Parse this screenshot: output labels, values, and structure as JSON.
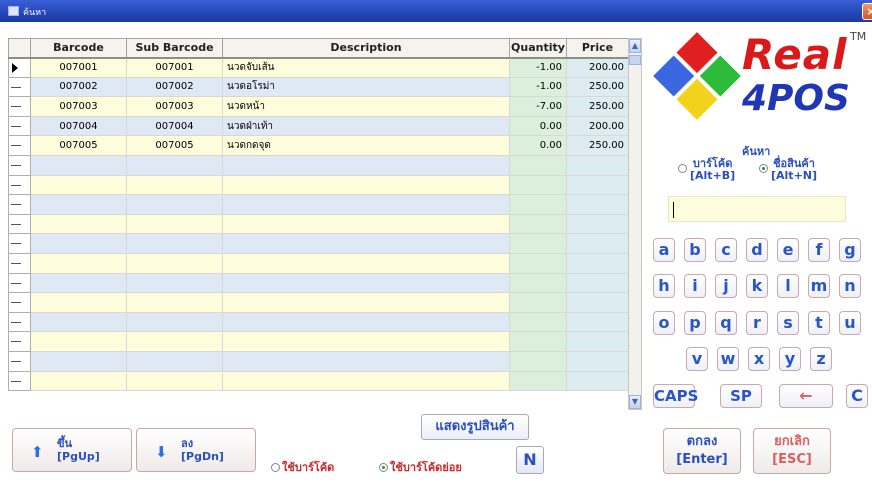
{
  "window": {
    "title": "ค้นหา",
    "close_label": "×"
  },
  "grid": {
    "columns": [
      "Barcode",
      "Sub Barcode",
      "Description",
      "Quantity",
      "Price"
    ],
    "rows": [
      {
        "barcode": "007001",
        "sub_barcode": "007001",
        "description": "นวดจับเส้น",
        "quantity": "-1.00",
        "price": "200.00"
      },
      {
        "barcode": "007002",
        "sub_barcode": "007002",
        "description": "นวดอโรม่า",
        "quantity": "-1.00",
        "price": "250.00"
      },
      {
        "barcode": "007003",
        "sub_barcode": "007003",
        "description": "นวดหน้า",
        "quantity": "-7.00",
        "price": "250.00"
      },
      {
        "barcode": "007004",
        "sub_barcode": "007004",
        "description": "นวดฝ่าเท้า",
        "quantity": "0.00",
        "price": "200.00"
      },
      {
        "barcode": "007005",
        "sub_barcode": "007005",
        "description": "นวดกดจุด",
        "quantity": "0.00",
        "price": "250.00"
      }
    ]
  },
  "bottom": {
    "pgup_label": "ขึ้น",
    "pgup_key": "[PgUp]",
    "pgdn_label": "ลง",
    "pgdn_key": "[PgDn]",
    "radio_barcode": "ใช้บาร์โค้ด",
    "radio_sub_barcode": "ใช้บาร์โค้ดย่อย",
    "show_image_label": "แสดงรูปสินค้า",
    "n_label": "N"
  },
  "right": {
    "logo_line1": "Real",
    "logo_line2": "4POS",
    "tm": "TM",
    "search_title": "ค้นหา",
    "option_barcode": "บาร์โค้ด",
    "option_barcode_key": "[Alt+B]",
    "option_name": "ชื่อสินค้า",
    "option_name_key": "[Alt+N]",
    "search_value": "",
    "keys_row1": [
      "a",
      "b",
      "c",
      "d",
      "e",
      "f",
      "g"
    ],
    "keys_row2": [
      "h",
      "i",
      "j",
      "k",
      "l",
      "m",
      "n"
    ],
    "keys_row3": [
      "o",
      "p",
      "q",
      "r",
      "s",
      "t",
      "u"
    ],
    "keys_row4": [
      "v",
      "w",
      "x",
      "y",
      "z"
    ],
    "caps_label": "CAPS",
    "sp_label": "SP",
    "backspace_label": "←",
    "clear_label": "C",
    "ok_label": "ตกลง",
    "ok_key": "[Enter]",
    "cancel_label": "ยกเลิก",
    "cancel_key": "[ESC]"
  },
  "colors": {
    "accent": "#2a4fbf",
    "danger": "#e05d5d",
    "row_yellow": "#fdfddc",
    "row_blue": "#dfe9f5"
  }
}
